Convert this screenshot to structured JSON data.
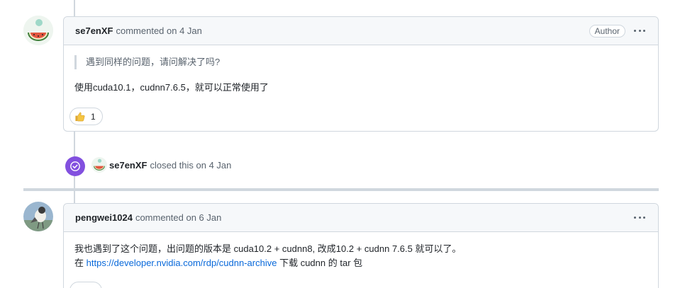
{
  "comment1": {
    "author": "se7enXF",
    "action": "commented on 4 Jan",
    "badge": "Author",
    "quote": "遇到同样的问题，请问解决了吗?",
    "body": "使用cuda10.1，cudnn7.6.5，就可以正常使用了",
    "reaction": {
      "icon": "thumbs-up-icon",
      "count": "1"
    }
  },
  "event": {
    "actor": "se7enXF",
    "text": "closed this on 4 Jan",
    "icon": "check-circle-icon",
    "color": "#8250df"
  },
  "comment2": {
    "author": "pengwei1024",
    "action": "commented on 6 Jan",
    "line1": "我也遇到了这个问题，出问题的版本是 cuda10.2 + cudnn8, 改成10.2 + cudnn 7.6.5 就可以了。",
    "line2_prefix": "在",
    "link": "https://developer.nvidia.com/rdp/cudnn-archive",
    "line2_suffix": "下载 cudnn 的 tar 包"
  },
  "colors": {
    "border": "#d0d7de",
    "header_bg": "#f6f8fa",
    "link": "#0969da",
    "muted": "#59636e"
  }
}
